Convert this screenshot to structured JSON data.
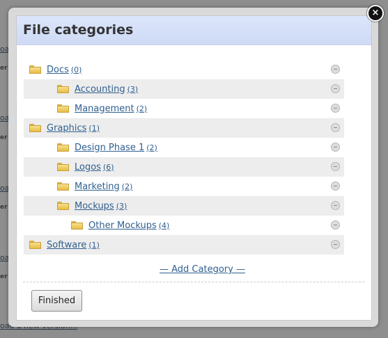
{
  "background": {
    "fragments": [
      "oad",
      "er",
      "er",
      "oad",
      "er",
      "oad",
      "er",
      "oad",
      "oad a new version..."
    ]
  },
  "dialog": {
    "title": "File categories",
    "close_label": "×",
    "add_category_label": "— Add Category —",
    "finished_label": "Finished"
  },
  "categories": [
    {
      "name": "Docs",
      "count": "(0)",
      "level": 0
    },
    {
      "name": "Accounting",
      "count": "(3)",
      "level": 1
    },
    {
      "name": "Management",
      "count": "(2)",
      "level": 1
    },
    {
      "name": "Graphics",
      "count": "(1)",
      "level": 0
    },
    {
      "name": "Design Phase 1",
      "count": "(2)",
      "level": 1
    },
    {
      "name": "Logos",
      "count": "(6)",
      "level": 1
    },
    {
      "name": "Marketing",
      "count": "(2)",
      "level": 1
    },
    {
      "name": "Mockups",
      "count": "(3)",
      "level": 1
    },
    {
      "name": "Other Mockups",
      "count": "(4)",
      "level": 2
    },
    {
      "name": "Software",
      "count": "(1)",
      "level": 0
    }
  ],
  "colors": {
    "header": "#dbe5fb",
    "link": "#2f5f8f",
    "row_alt": "#ededed"
  }
}
